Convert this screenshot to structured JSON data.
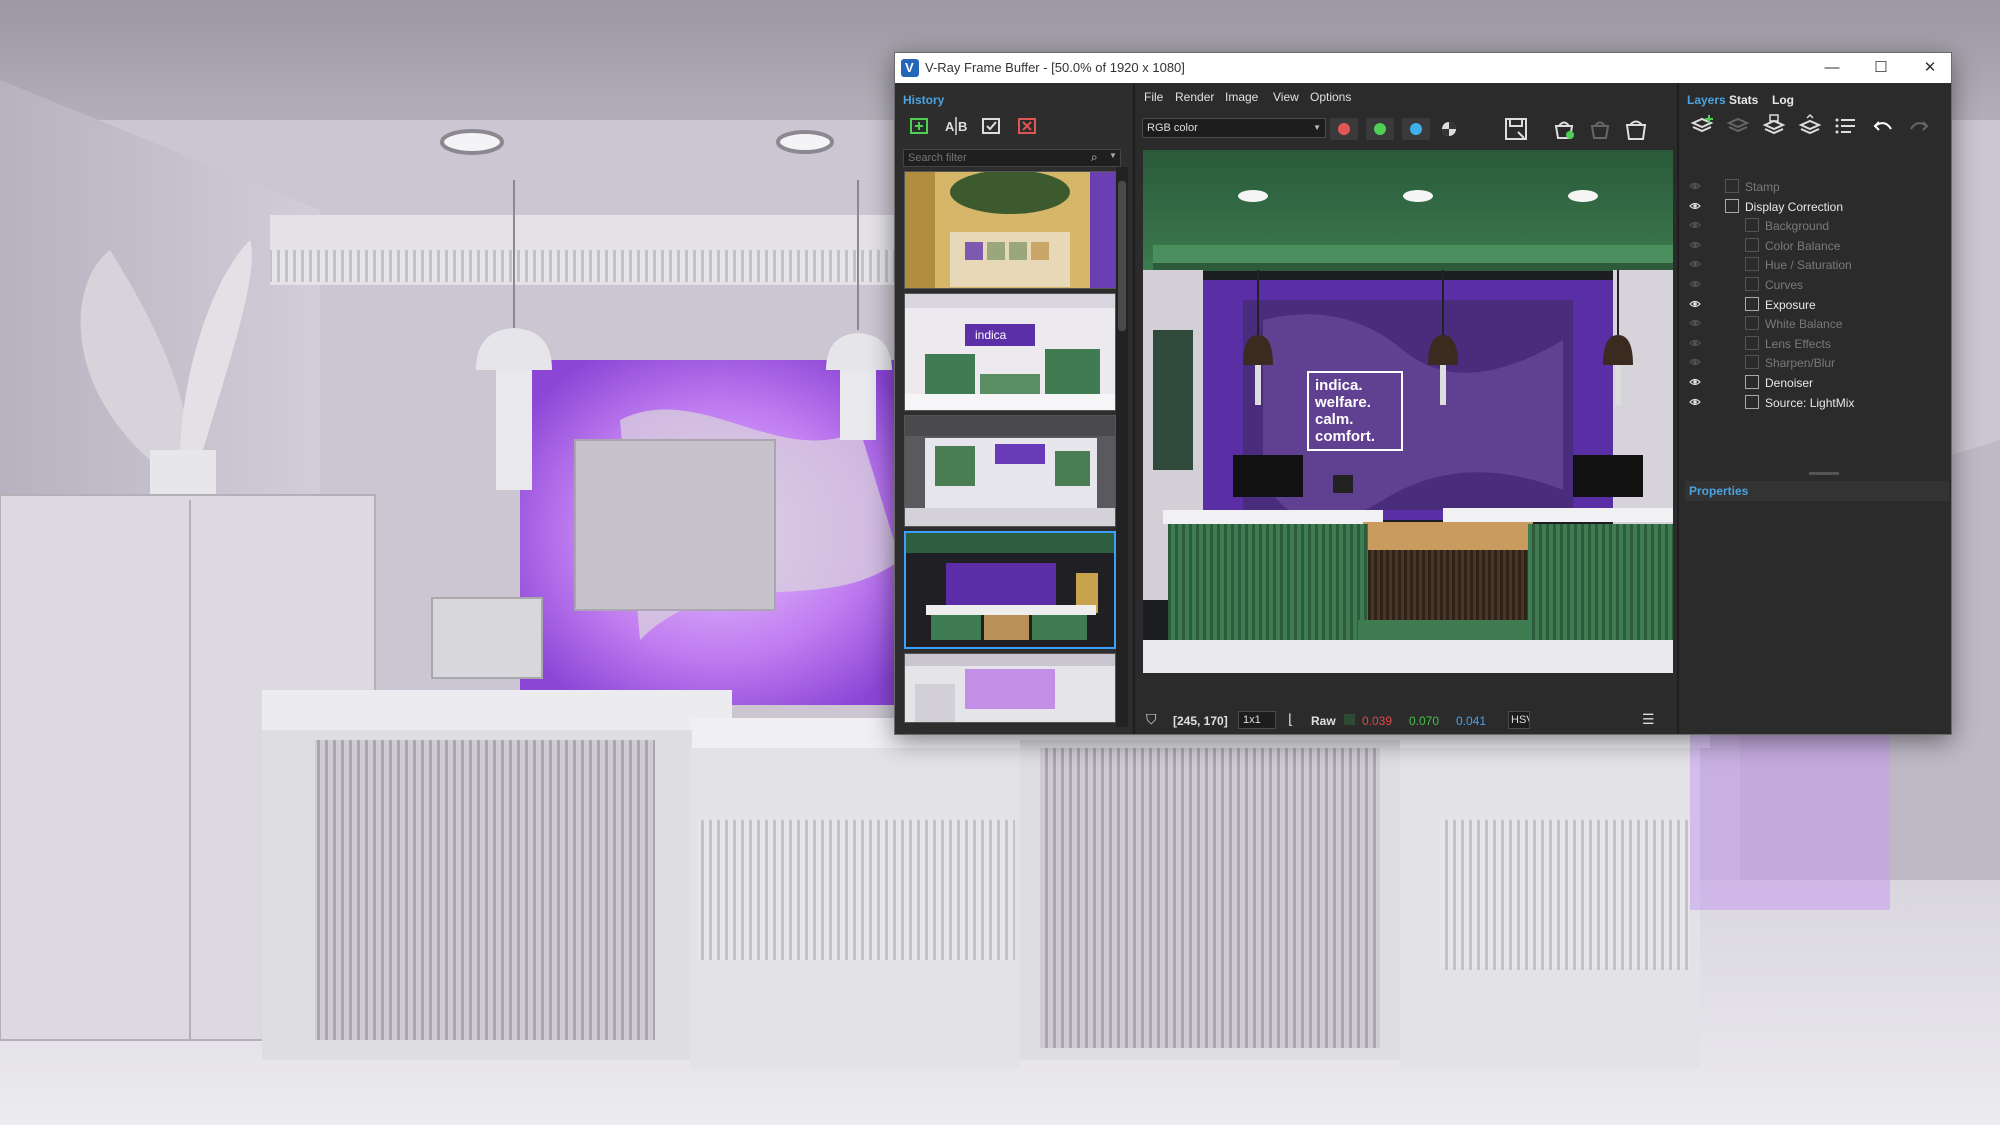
{
  "window": {
    "title": "V-Ray Frame Buffer - [50.0% of 1920 x 1080]",
    "controls": {
      "minimize": "—",
      "maximize": "☐",
      "close": "✕"
    }
  },
  "history": {
    "tab_label": "History",
    "tools": [
      "save-to-history-icon",
      "ab-compare-icon",
      "load-history-icon",
      "remove-history-icon"
    ],
    "search_placeholder": "Search filter",
    "selected_index": 3
  },
  "menu": {
    "file": "File",
    "render": "Render",
    "image": "Image",
    "view": "View",
    "options": "Options"
  },
  "toolbar": {
    "channel": "RGB color",
    "red_color": "#e25555",
    "green_color": "#4fcf55",
    "blue_color": "#3fb0ea"
  },
  "render": {
    "sign_lines": [
      "indica.",
      "welfare.",
      "calm.",
      "comfort."
    ],
    "brand_text": "indica"
  },
  "status": {
    "coords": "[245, 170]",
    "zoom": "1x1",
    "mode": "Raw",
    "r": "0.039",
    "g": "0.070",
    "b": "0.041",
    "space": "HSV",
    "r_color": "#e04848",
    "g_color": "#48c048",
    "b_color": "#4aa0e8"
  },
  "layers": {
    "tabs": [
      "Layers",
      "Stats",
      "Log"
    ],
    "items": [
      {
        "name": "Stamp",
        "enabled": false,
        "indent": 0
      },
      {
        "name": "Display Correction",
        "enabled": true,
        "indent": 0
      },
      {
        "name": "Background",
        "enabled": false,
        "indent": 1
      },
      {
        "name": "Color Balance",
        "enabled": false,
        "indent": 1
      },
      {
        "name": "Hue / Saturation",
        "enabled": false,
        "indent": 1
      },
      {
        "name": "Curves",
        "enabled": false,
        "indent": 1
      },
      {
        "name": "Exposure",
        "enabled": true,
        "indent": 1
      },
      {
        "name": "White Balance",
        "enabled": false,
        "indent": 1
      },
      {
        "name": "Lens Effects",
        "enabled": false,
        "indent": 1
      },
      {
        "name": "Sharpen/Blur",
        "enabled": false,
        "indent": 1
      },
      {
        "name": "Denoiser",
        "enabled": true,
        "indent": 1
      },
      {
        "name": "Source: LightMix",
        "enabled": true,
        "indent": 1
      }
    ],
    "properties_label": "Properties"
  }
}
